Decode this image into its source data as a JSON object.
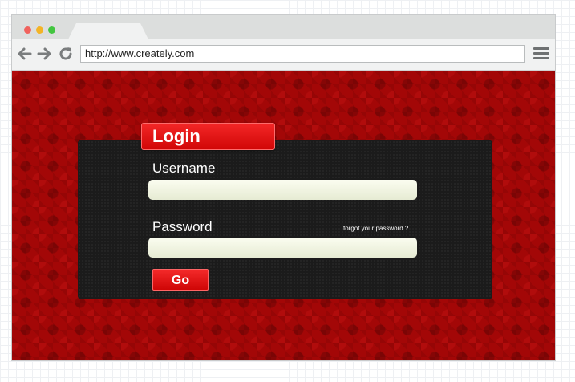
{
  "browser": {
    "url": "http://www.creately.com"
  },
  "login": {
    "title": "Login",
    "username_label": "Username",
    "username_value": "",
    "password_label": "Password",
    "password_value": "",
    "forgot_link": "forgot your password ?",
    "submit_label": "Go"
  },
  "colors": {
    "background": "#a30707",
    "panel": "#1b1b1b",
    "accent": "#e31414"
  }
}
